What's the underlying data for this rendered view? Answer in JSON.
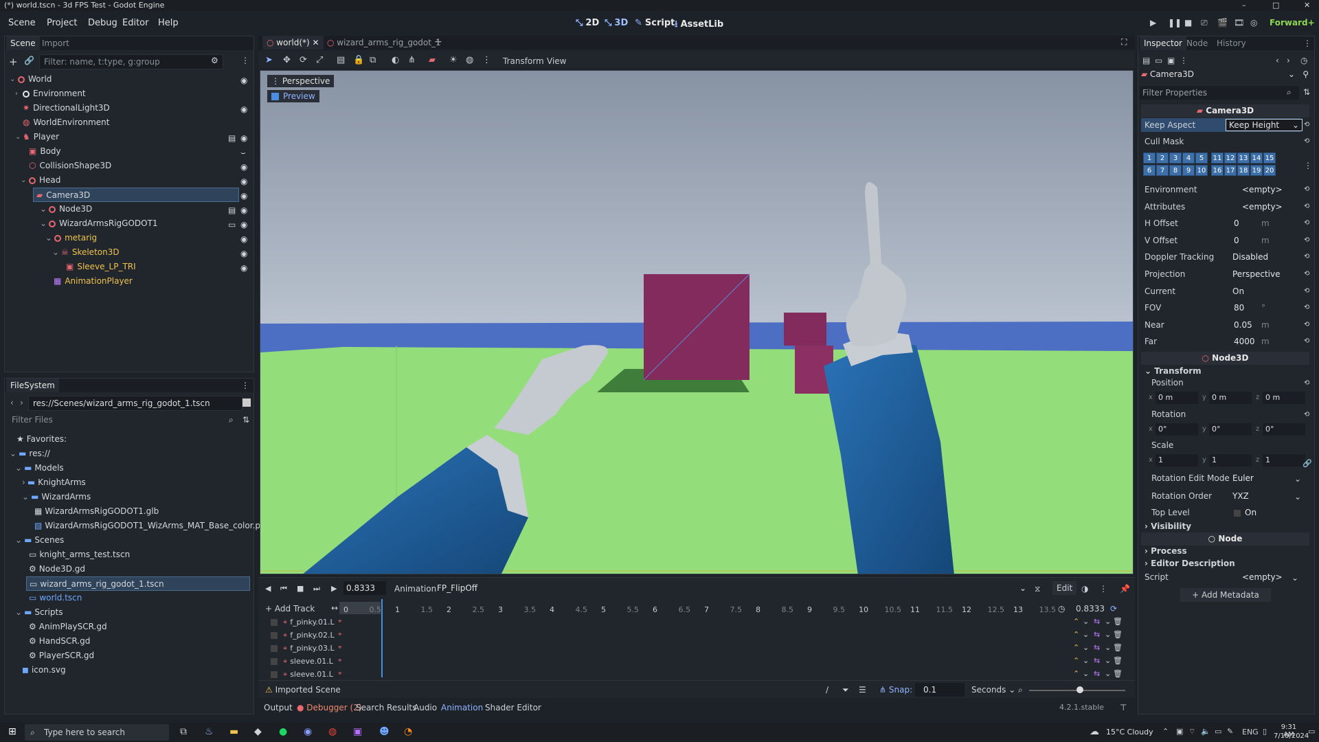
{
  "window": {
    "title": "(*) world.tscn - 3d FPS Test - Godot Engine",
    "controls": [
      "–",
      "□",
      "✕"
    ]
  },
  "menu": [
    "Scene",
    "Project",
    "Debug",
    "Editor",
    "Help"
  ],
  "workspaces": [
    {
      "icon": "⤡",
      "label": "2D"
    },
    {
      "icon": "⤡",
      "label": "3D"
    },
    {
      "icon": "✎",
      "label": "Script"
    },
    {
      "icon": "⭳",
      "label": "AssetLib"
    }
  ],
  "renderer": "Forward+",
  "scene_dock": {
    "tabs": [
      "Scene",
      "Import"
    ],
    "filter_placeholder": "Filter: name, t:type, g:group",
    "nodes": [
      "World",
      "Environment",
      "DirectionalLight3D",
      "WorldEnvironment",
      "Player",
      "Body",
      "CollisionShape3D",
      "Head",
      "Camera3D",
      "Node3D",
      "WizardArmsRigGODOT1",
      "metarig",
      "Skeleton3D",
      "Sleeve_LP_TRI",
      "AnimationPlayer"
    ]
  },
  "filesystem": {
    "title": "FileSystem",
    "path": "res://Scenes/wizard_arms_rig_godot_1.tscn",
    "filter_placeholder": "Filter Files",
    "items": [
      "Favorites:",
      "res://",
      "Models",
      "KnightArms",
      "WizardArms",
      "WizardArmsRigGODOT1.glb",
      "WizardArmsRigGODOT1_WizArms_MAT_Base_color.png",
      "Scenes",
      "knight_arms_test.tscn",
      "Node3D.gd",
      "wizard_arms_rig_godot_1.tscn",
      "world.tscn",
      "Scripts",
      "AnimPlaySCR.gd",
      "HandSCR.gd",
      "PlayerSCR.gd",
      "icon.svg"
    ]
  },
  "editor_tabs": [
    "world(*)",
    "wizard_arms_rig_godot_1"
  ],
  "toolbar": {
    "transform": "Transform",
    "view": "View"
  },
  "viewport": {
    "perspective": "Perspective",
    "preview": "Preview"
  },
  "animation": {
    "time": "0.8333",
    "label": "Animation",
    "name": "FP_FlipOff",
    "edit": "Edit",
    "add_track": "Add Track",
    "length": "0.8333",
    "ruler": [
      "0",
      "0.5",
      "1",
      "1.5",
      "2",
      "2.5",
      "3",
      "3.5",
      "4",
      "4.5",
      "5",
      "5.5",
      "6",
      "6.5",
      "7",
      "7.5",
      "8",
      "8.5",
      "9",
      "9.5",
      "10",
      "10.5",
      "11",
      "11.5",
      "12",
      "12.5",
      "13",
      "13.5"
    ],
    "tracks": [
      "f_pinky.01.L",
      "f_pinky.02.L",
      "f_pinky.03.L",
      "sleeve.01.L",
      "sleeve.01.L"
    ],
    "imported": "Imported Scene",
    "snap_label": "Snap:",
    "snap": "0.1",
    "units": "Seconds"
  },
  "bottom_tabs": [
    "Output",
    "Debugger (2)",
    "Search Results",
    "Audio",
    "Animation",
    "Shader Editor"
  ],
  "version": "4.2.1.stable",
  "inspector": {
    "tabs": [
      "Inspector",
      "Node",
      "History"
    ],
    "object": "Camera3D",
    "filter_placeholder": "Filter Properties",
    "class": "Camera3D",
    "keep_aspect": {
      "label": "Keep Aspect",
      "value": "Keep Height"
    },
    "cull_mask_label": "Cull Mask",
    "cull_mask": [
      "1",
      "2",
      "3",
      "4",
      "5",
      "11",
      "12",
      "13",
      "14",
      "15",
      "6",
      "7",
      "8",
      "9",
      "10",
      "16",
      "17",
      "18",
      "19",
      "20"
    ],
    "props": [
      {
        "label": "Environment",
        "value": "<empty>"
      },
      {
        "label": "Attributes",
        "value": "<empty>"
      },
      {
        "label": "H Offset",
        "value": "0",
        "unit": "m"
      },
      {
        "label": "V Offset",
        "value": "0",
        "unit": "m"
      },
      {
        "label": "Doppler Tracking",
        "value": "Disabled"
      },
      {
        "label": "Projection",
        "value": "Perspective"
      },
      {
        "label": "Current",
        "value": "On"
      },
      {
        "label": "FOV",
        "value": "80",
        "unit": "°"
      },
      {
        "label": "Near",
        "value": "0.05",
        "unit": "m"
      },
      {
        "label": "Far",
        "value": "4000",
        "unit": "m"
      }
    ],
    "node3d": "Node3D",
    "transform": "Transform",
    "position": "Position",
    "rotation": "Rotation",
    "scale": "Scale",
    "pos": [
      "0 m",
      "0 m",
      "0 m"
    ],
    "rot": [
      "0°",
      "0°",
      "0°"
    ],
    "scl": [
      "1",
      "1",
      "1"
    ],
    "axes": [
      "x",
      "y",
      "z"
    ],
    "rem": {
      "label": "Rotation Edit Mode",
      "value": "Euler"
    },
    "ro": {
      "label": "Rotation Order",
      "value": "YXZ"
    },
    "tl": {
      "label": "Top Level",
      "value": "On"
    },
    "visibility": "Visibility",
    "node": "Node",
    "process": "Process",
    "editor_desc": "Editor Description",
    "script": {
      "label": "Script",
      "value": "<empty>"
    },
    "add_meta": "Add Metadata"
  },
  "taskbar": {
    "search": "Type here to search",
    "weather": "15°C  Cloudy",
    "lang": "ENG",
    "time": "9:31 AM",
    "date": "7/10/2024"
  },
  "colors": {
    "accent": "#4b8de0",
    "sky": "#8a96a8",
    "ground": "#8fd978",
    "box": "#822a5a",
    "sleeve": "#1f5f9a"
  }
}
